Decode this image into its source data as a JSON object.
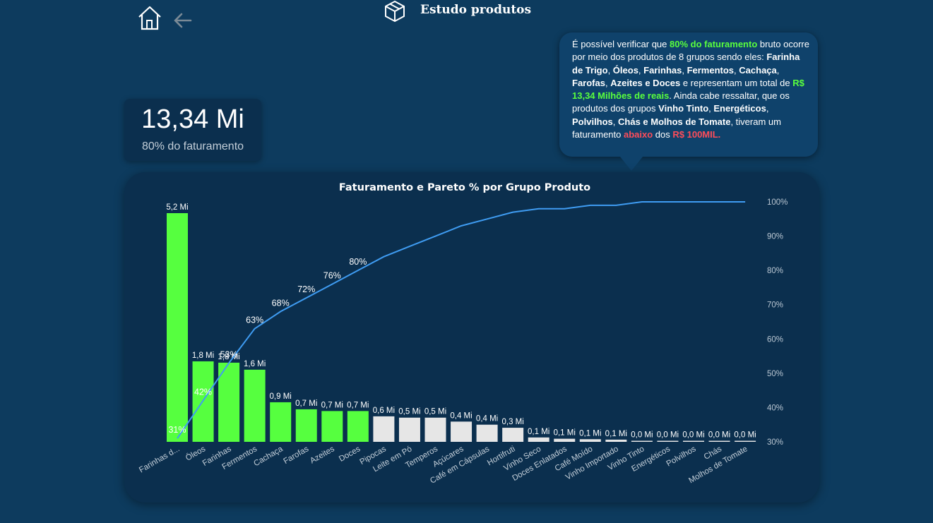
{
  "header": {
    "title": "Estudo produtos"
  },
  "kpi": {
    "value": "13,34 Mi",
    "label": "80% do faturamento"
  },
  "note": {
    "t1": "É possível verificar que ",
    "h1": "80% do faturamento",
    "t2": " bruto ocorre por meio dos produtos de 8 grupos sendo eles: ",
    "b1": "Farinha de Trigo",
    "t3": ", ",
    "b2": "Óleos",
    "t4": ", ",
    "b3": "Farinhas",
    "t5": ", ",
    "b4": "Fermentos",
    "t6": ", ",
    "b5": "Cachaça",
    "t7": ", ",
    "b6": "Farofas",
    "t8": ", ",
    "b7": "Azeites e Doces",
    "t9": " e representam um total de ",
    "h2": "R$ 13,34 Milhões de reais",
    "t10": ".  Ainda cabe ressaltar, que os produtos  dos grupos ",
    "b8": "Vinho Tinto",
    "t11": ", ",
    "b9": "Energéticos",
    "t12": ", ",
    "b10": "Polvilhos",
    "t13": ", ",
    "b11": "Chás e Molhos de Tomate",
    "t14": ", tiveram um faturamento ",
    "r1": "abaixo",
    "t15": " dos ",
    "r2": "R$ 100MIL."
  },
  "chart_data": {
    "type": "bar",
    "title": "Faturamento e Pareto % por Grupo Produto",
    "categories": [
      "Farinhas d...",
      "Óleos",
      "Farinhas",
      "Fermentos",
      "Cachaça",
      "Farofas",
      "Azeites",
      "Doces",
      "Pipocas",
      "Leite em Pó",
      "Temperos",
      "Açúcares",
      "Café em Cápsulas",
      "Hortifruti",
      "Vinho Seco",
      "Doces Enlatados",
      "Café Moído",
      "Vinho Importado",
      "Vinho Tinto",
      "Energéticos",
      "Polvilhos",
      "Chás",
      "Molhos de Tomate"
    ],
    "series": [
      {
        "values": [
          5.2,
          1.8,
          1.8,
          1.6,
          0.9,
          0.7,
          0.7,
          0.7,
          0.6,
          0.5,
          0.5,
          0.4,
          0.4,
          0.3,
          0.1,
          0.1,
          0.1,
          0.1,
          0.0,
          0.0,
          0.0,
          0.0,
          0.0
        ],
        "labels": [
          "5,2 Mi",
          "1,8 Mi",
          "1,8 Mi",
          "1,6 Mi",
          "0,9 Mi",
          "0,7 Mi",
          "0,7 Mi",
          "0,7 Mi",
          "0,6 Mi",
          "0,5 Mi",
          "0,5 Mi",
          "0,4 Mi",
          "0,4 Mi",
          "0,3 Mi",
          "0,1 Mi",
          "0,1 Mi",
          "0,1 Mi",
          "0,1 Mi",
          "0,0 Mi",
          "0,0 Mi",
          "0,0 Mi",
          "0,0 Mi",
          "0,0 Mi"
        ],
        "bar_heights": [
          5.2,
          1.83,
          1.8,
          1.64,
          0.9,
          0.74,
          0.7,
          0.7,
          0.58,
          0.55,
          0.55,
          0.46,
          0.39,
          0.32,
          0.1,
          0.07,
          0.06,
          0.05,
          0.02,
          0.01,
          0.01,
          0.01,
          0.01
        ],
        "highlight_count": 8
      },
      {
        "values": [
          31,
          42,
          53,
          63,
          68,
          72,
          76,
          80,
          84,
          87,
          90,
          93,
          95,
          97,
          98,
          98,
          99,
          99,
          100,
          100,
          100,
          100,
          100
        ],
        "point_labels": [
          "31%",
          "42%",
          "53%",
          "63%",
          "68%",
          "72%",
          "76%",
          "80%"
        ]
      }
    ],
    "y2_ticks": [
      "30%",
      "40%",
      "50%",
      "60%",
      "70%",
      "80%",
      "90%",
      "100%"
    ],
    "y2lim": [
      30,
      100
    ],
    "colors": {
      "highlight_bar": "#56ff3f",
      "other_bar": "#e6e6e6",
      "pareto_line": "#3f9cf2",
      "panel": "#0b2f4e"
    }
  },
  "colors": {
    "background": "#0d3b5e",
    "accent_green": "#59ff3d",
    "accent_red": "#ff4d5a"
  }
}
